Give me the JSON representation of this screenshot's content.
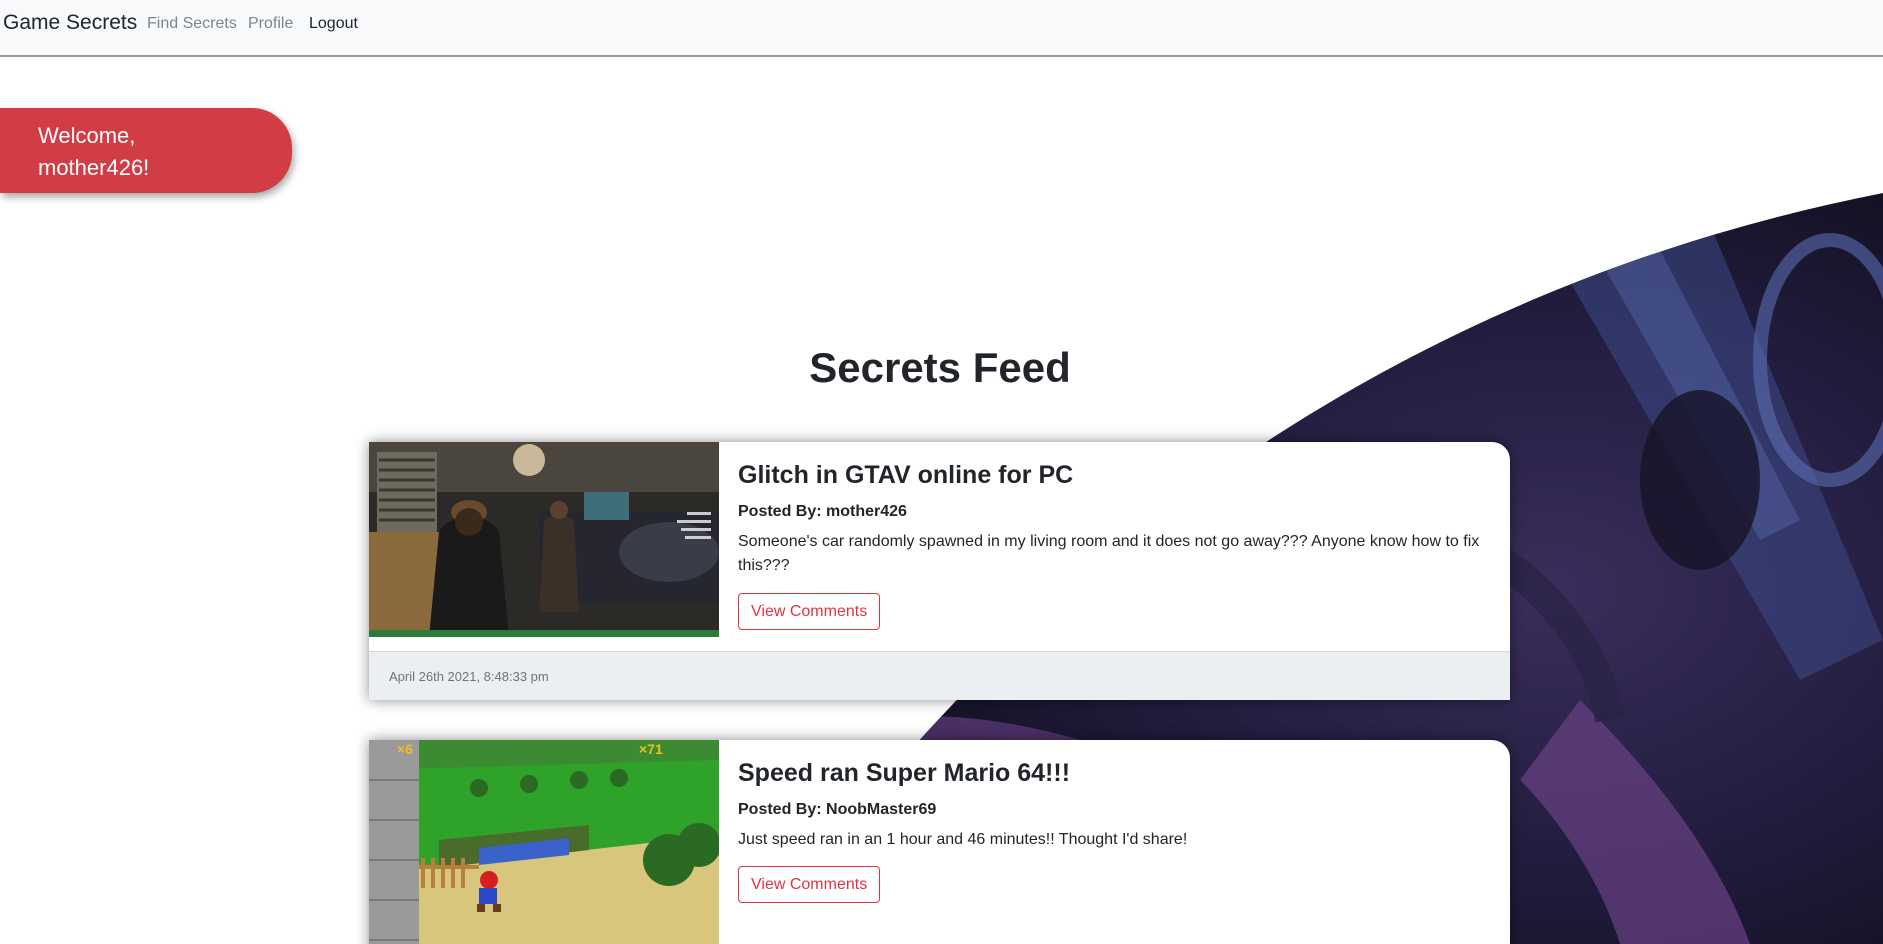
{
  "navbar": {
    "brand": "Game Secrets",
    "links": [
      {
        "label": "Find Secrets"
      },
      {
        "label": "Profile"
      },
      {
        "label": "Logout"
      }
    ]
  },
  "welcome": {
    "line1": "Welcome,",
    "line2": "mother426!"
  },
  "feed": {
    "title": "Secrets Feed",
    "posts": [
      {
        "title": "Glitch in GTAV online for PC",
        "author": "Posted By: mother426",
        "text": "Someone's car randomly spawned in my living room and it does not go away??? Anyone know how to fix this???",
        "button": "View Comments",
        "date": "April 26th 2021, 8:48:33 pm"
      },
      {
        "title": "Speed ran Super Mario 64!!!",
        "author": "Posted By: NoobMaster69",
        "text": "Just speed ran in an 1 hour and 46 minutes!! Thought I'd share!",
        "button": "View Comments",
        "hud_left": "×6",
        "hud_right": "×71"
      }
    ]
  },
  "colors": {
    "accent": "#dc3545",
    "welcome_bg": "#d13c45",
    "navbar_bg": "#f8f9fa",
    "footer_bg": "#eceff1",
    "art_dark": "#1c1a36"
  }
}
